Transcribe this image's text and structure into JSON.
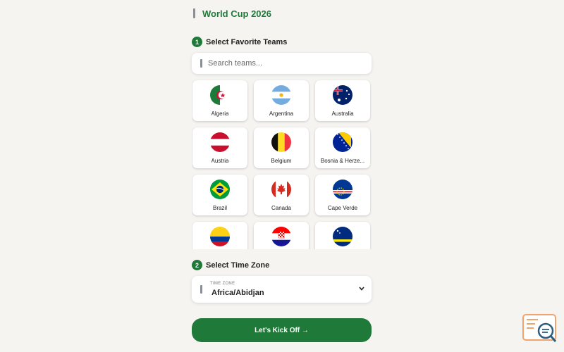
{
  "header": {
    "title": "World Cup 2026",
    "icon": "calendar-icon"
  },
  "step1": {
    "number": "1",
    "label": "Select Favorite Teams"
  },
  "search": {
    "placeholder": "Search teams..."
  },
  "teams": [
    {
      "name": "Algeria",
      "flag": "algeria"
    },
    {
      "name": "Argentina",
      "flag": "argentina"
    },
    {
      "name": "Australia",
      "flag": "australia"
    },
    {
      "name": "Austria",
      "flag": "austria"
    },
    {
      "name": "Belgium",
      "flag": "belgium"
    },
    {
      "name": "Bosnia & Herze...",
      "flag": "bosnia"
    },
    {
      "name": "Brazil",
      "flag": "brazil"
    },
    {
      "name": "Canada",
      "flag": "canada"
    },
    {
      "name": "Cape Verde",
      "flag": "capeverde"
    },
    {
      "name": "",
      "flag": "colombia"
    },
    {
      "name": "",
      "flag": "croatia"
    },
    {
      "name": "",
      "flag": "curacao"
    }
  ],
  "step2": {
    "number": "2",
    "label": "Select Time Zone"
  },
  "timezone": {
    "label": "TIME ZONE",
    "value": "Africa/Abidjan"
  },
  "cta": {
    "label": "Let's Kick Off →"
  },
  "colors": {
    "accent": "#1f7a3a",
    "background": "#f5f4f1"
  }
}
